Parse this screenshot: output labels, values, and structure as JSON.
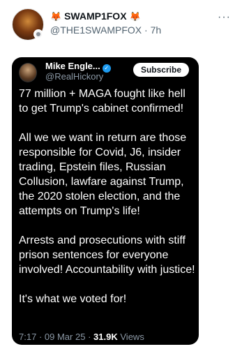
{
  "post": {
    "author_name": "SWAMP1FOX",
    "name_emoji_left": "🦊",
    "name_emoji_right": "🦊",
    "handle": "@THE1SWAMPFOX",
    "separator": "·",
    "timestamp": "7h",
    "more_icon": "···"
  },
  "embed": {
    "author_name": "Mike Engle...",
    "verified_icon": "✓",
    "handle": "@RealHickory",
    "subscribe_label": "Subscribe",
    "paragraphs": [
      "77 million + MAGA fought like hell to get Trump's cabinet confirmed!",
      "All we we want in return are those responsible for Covid, J6, insider trading, Epstein files, Russian Collusion, lawfare against Trump, the 2020 stolen election, and the attempts on Trump's life!",
      "Arrests and prosecutions with stiff prison sentences for everyone involved! Accountability with justice!",
      "It's what we voted for!"
    ],
    "footer_time": "7:17",
    "footer_sep1": "·",
    "footer_date": "09 Mar 25",
    "footer_sep2": "·",
    "footer_views_count": "31.9K",
    "footer_views_label": "Views"
  },
  "colors": {
    "accent": "#1d9bf0",
    "text_primary": "#0f1419",
    "text_secondary": "#536471",
    "embed_bg": "#000000"
  }
}
